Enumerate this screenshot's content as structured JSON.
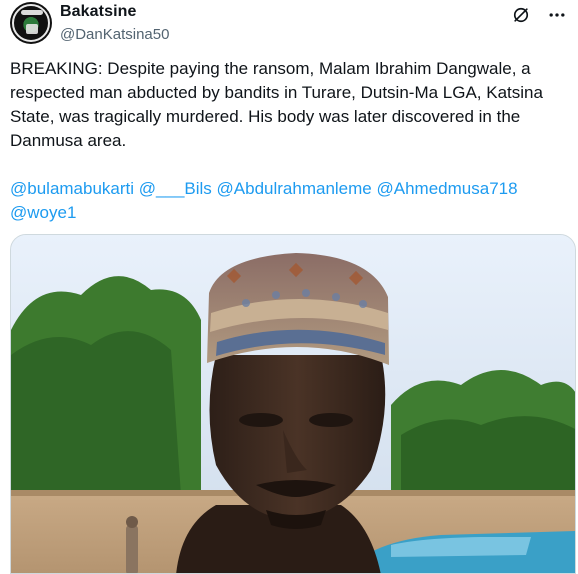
{
  "tweet": {
    "display_name": "Bakatsine",
    "handle": "@DanKatsina50",
    "body": "BREAKING: Despite paying the ransom, Malam Ibrahim Dangwale, a respected man abducted by bandits in Turare, Dutsin-Ma LGA, Katsina State, was tragically murdered. His body was later discovered in the Danmusa area.",
    "mentions": [
      "@bulamabukarti",
      "@___Bils",
      "@Abdulrahmanleme",
      "@Ahmedmusa718",
      "@woye1"
    ]
  },
  "icons": {
    "grok": "grok-slash-icon",
    "more": "more-horizontal-icon"
  },
  "colors": {
    "link": "#1d9bf0",
    "text": "#0f1419",
    "secondary": "#536471"
  }
}
